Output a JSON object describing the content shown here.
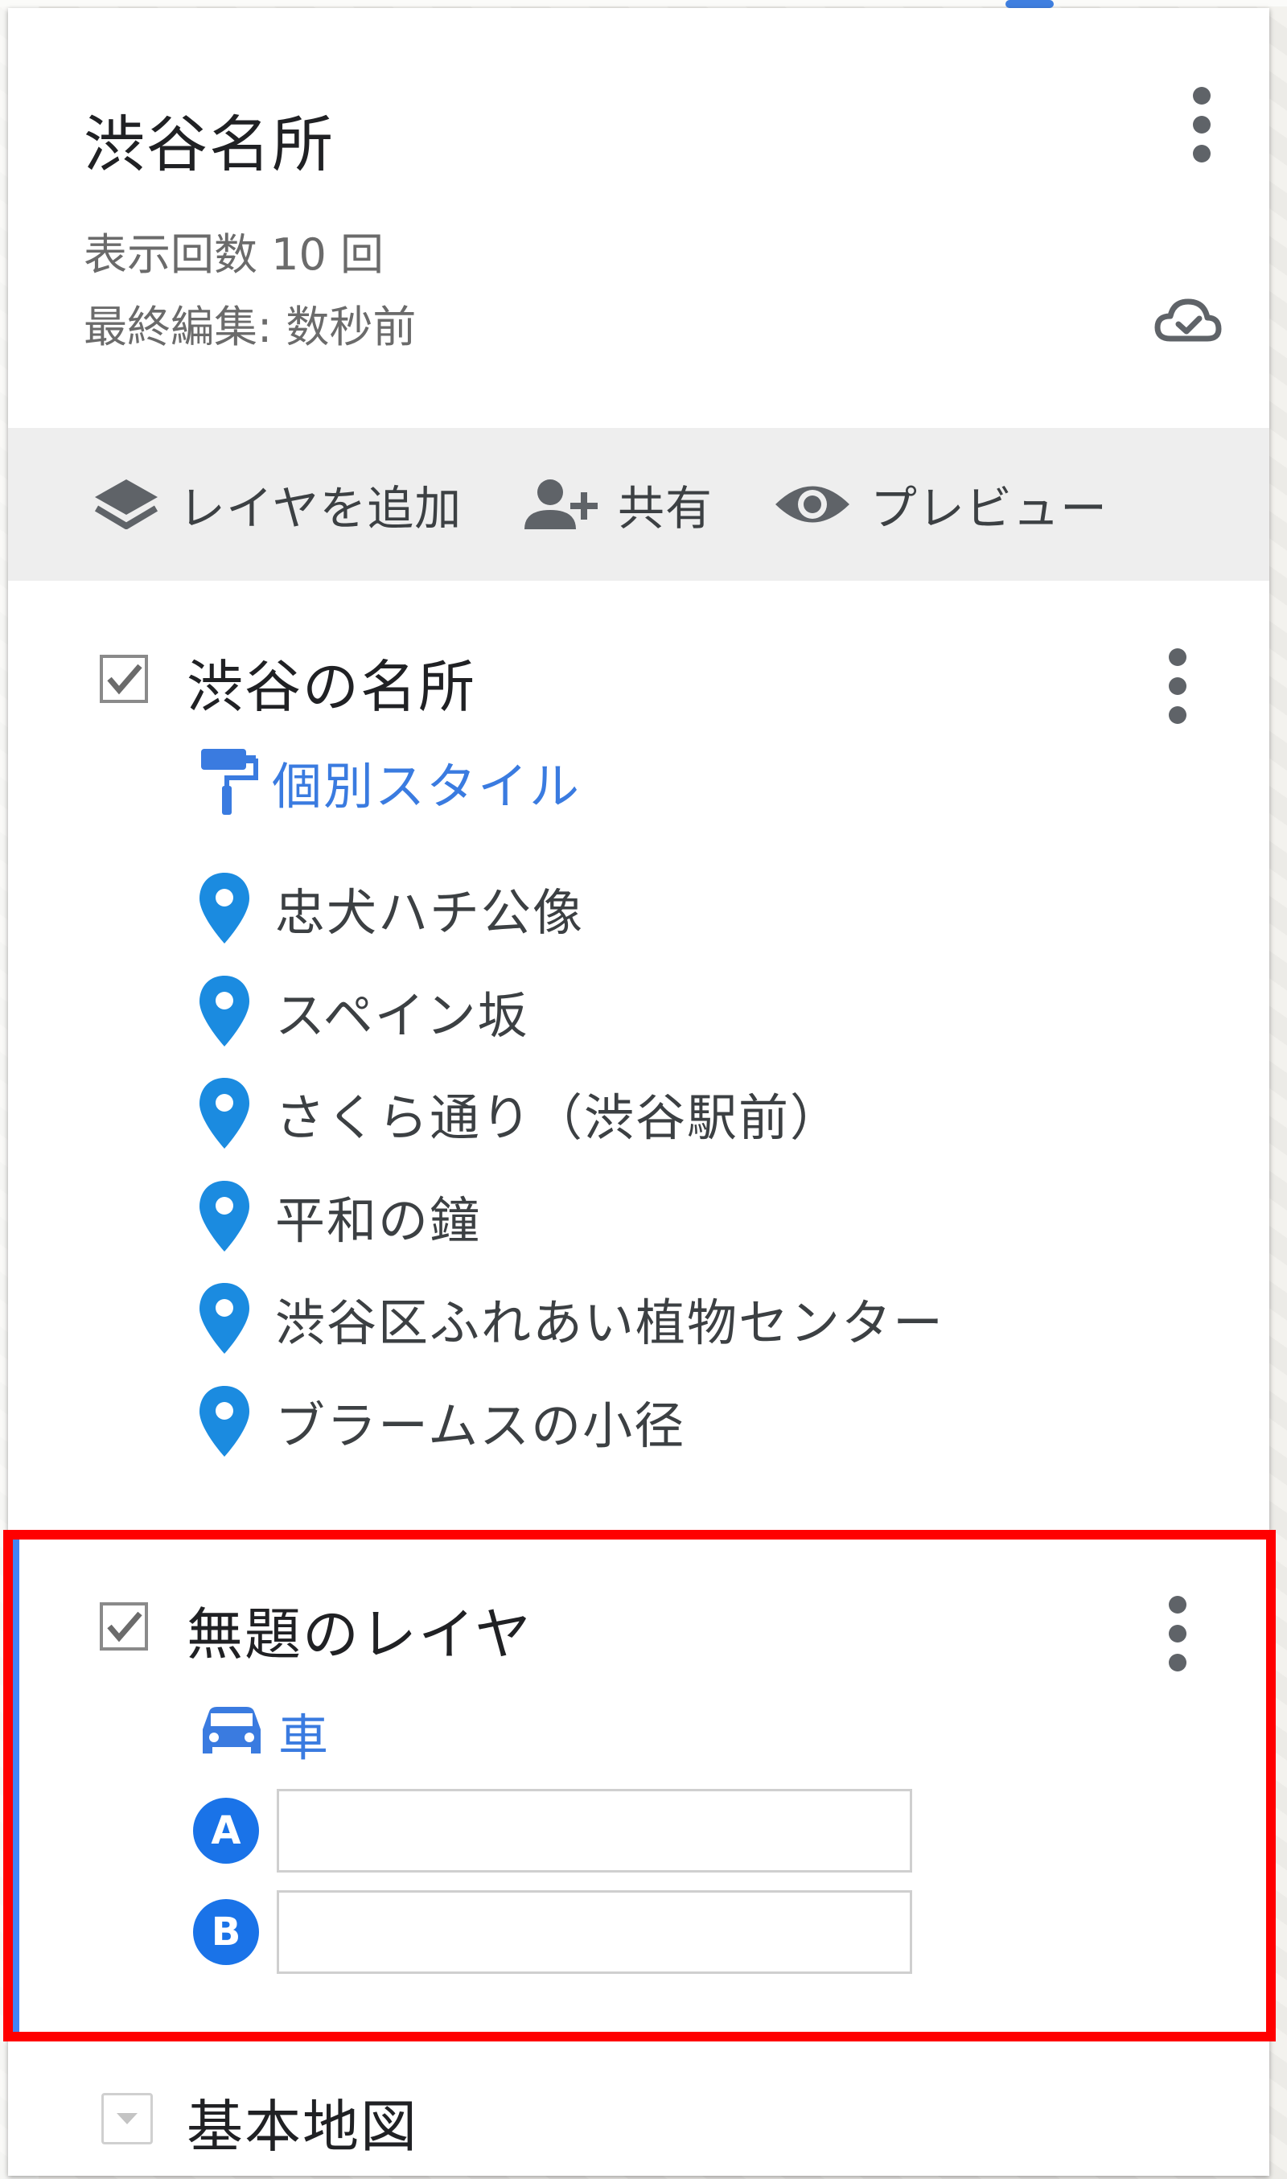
{
  "header": {
    "title": "渋谷名所",
    "view_count": "表示回数 10 回",
    "last_edited": "最終編集: 数秒前"
  },
  "toolbar": {
    "add_layer": "レイヤを追加",
    "share": "共有",
    "preview": "プレビュー"
  },
  "layers": [
    {
      "title": "渋谷の名所",
      "checked": true,
      "style_label": "個別スタイル",
      "places": [
        "忠犬ハチ公像",
        "スペイン坂",
        "さくら通り（渋谷駅前）",
        "平和の鐘",
        "渋谷区ふれあい植物センター",
        "ブラームスの小径"
      ]
    },
    {
      "title": "無題のレイヤ",
      "checked": true,
      "mode_label": "車",
      "waypoints": [
        {
          "badge": "A",
          "value": "",
          "placeholder": ""
        },
        {
          "badge": "B",
          "value": "",
          "placeholder": ""
        }
      ]
    }
  ],
  "base_map": {
    "title": "基本地図"
  },
  "colors": {
    "accent_blue": "#3a7be0",
    "pin_blue": "#1b8be0",
    "badge_blue": "#1a73e8",
    "selection_bar": "#4285f4",
    "highlight_red": "#ff0000",
    "toolbar_bg": "#eeeeee"
  }
}
